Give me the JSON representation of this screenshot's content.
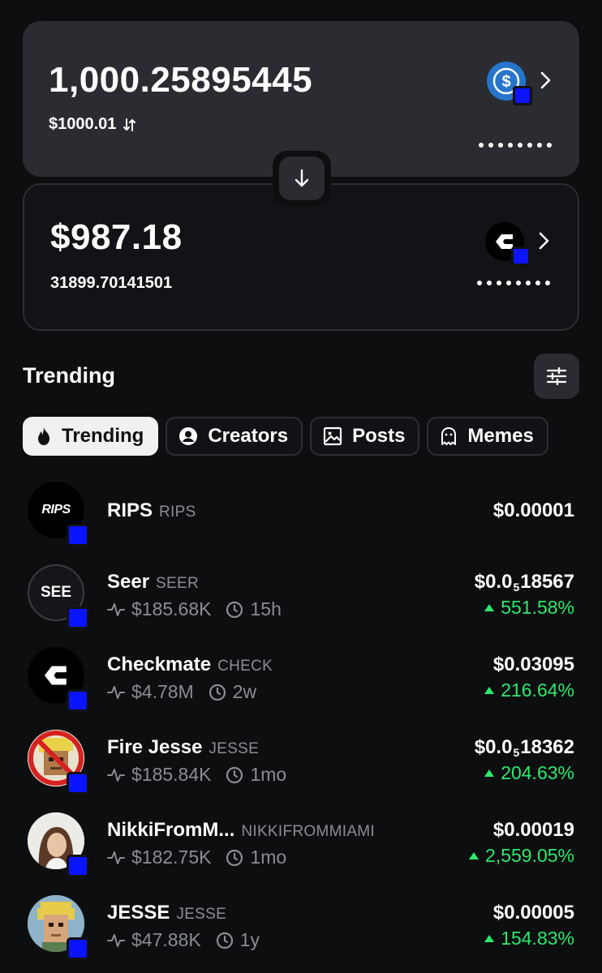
{
  "swap": {
    "from": {
      "amount": "1,000.25895445",
      "usd_value": "$1000.01",
      "token_icon": "usdc-icon"
    },
    "to": {
      "amount": "$987.18",
      "token_amount": "31899.70141501",
      "token_icon": "checkmate-icon"
    }
  },
  "section": {
    "title": "Trending"
  },
  "tabs": [
    {
      "label": "Trending",
      "icon": "flame-icon",
      "active": true
    },
    {
      "label": "Creators",
      "icon": "user-circle-icon",
      "active": false
    },
    {
      "label": "Posts",
      "icon": "image-icon",
      "active": false
    },
    {
      "label": "Memes",
      "icon": "ghost-icon",
      "active": false
    }
  ],
  "tokens": [
    {
      "name": "RIPS",
      "ticker": "RIPS",
      "price": "$0.00001",
      "market_cap": "",
      "age": "",
      "change": ""
    },
    {
      "name": "Seer",
      "ticker": "SEER",
      "price_prefix": "$0.0",
      "price_sub": "5",
      "price_suffix": "18567",
      "market_cap": "$185.68K",
      "age": "15h",
      "change": "551.58%"
    },
    {
      "name": "Checkmate",
      "ticker": "CHECK",
      "price": "$0.03095",
      "market_cap": "$4.78M",
      "age": "2w",
      "change": "216.64%"
    },
    {
      "name": "Fire Jesse",
      "ticker": "JESSE",
      "price_prefix": "$0.0",
      "price_sub": "5",
      "price_suffix": "18362",
      "market_cap": "$185.84K",
      "age": "1mo",
      "change": "204.63%"
    },
    {
      "name": "NikkiFromM...",
      "ticker": "NIKKIFROMMIAMI",
      "price": "$0.00019",
      "market_cap": "$182.75K",
      "age": "1mo",
      "change": "2,559.05%"
    },
    {
      "name": "JESSE",
      "ticker": "JESSE",
      "price": "$0.00005",
      "market_cap": "$47.88K",
      "age": "1y",
      "change": "154.83%"
    }
  ],
  "avatars": {
    "rips_text": "RIPS",
    "seer_text": "SEE"
  },
  "colors": {
    "background": "#0d0e10",
    "card": "#2a2c31",
    "positive": "#2ee86b",
    "muted": "#8a8d93",
    "chain_badge": "#0a14ff",
    "usdc": "#2775ca"
  }
}
